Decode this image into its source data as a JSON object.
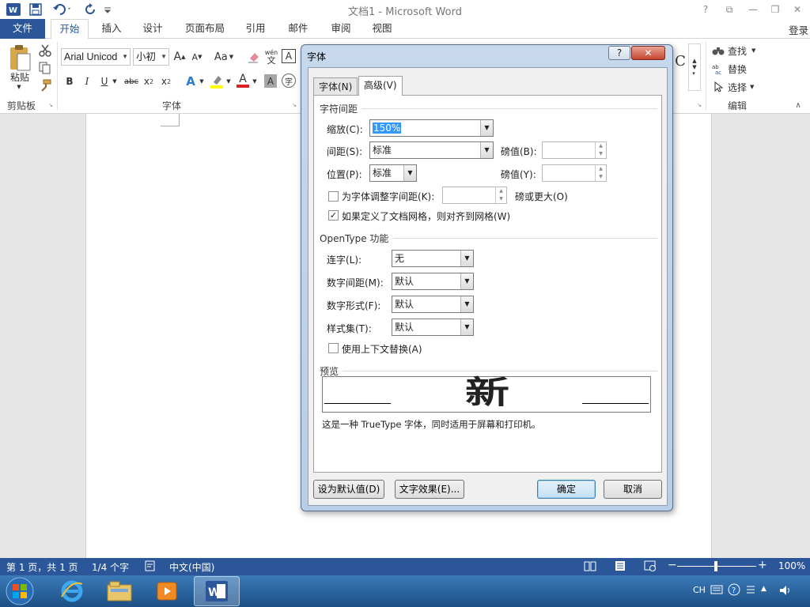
{
  "titlebar": {
    "title": "文档1 - Microsoft Word",
    "help": "?",
    "restore_ribbon": "⧉",
    "minimize": "—",
    "maximize": "❐",
    "close": "✕"
  },
  "tabs": {
    "file": "文件",
    "items": [
      "开始",
      "插入",
      "设计",
      "页面布局",
      "引用",
      "邮件",
      "审阅",
      "视图"
    ],
    "login": "登录"
  },
  "ribbon": {
    "clipboard": {
      "paste": "粘贴",
      "label": "剪贴板"
    },
    "font": {
      "font_name": "Arial Unicod",
      "font_size": "小初",
      "grow": "A",
      "shrink": "A",
      "case": "Aa",
      "pinyin_top": "wén",
      "pinyin_bottom": "文",
      "border_char": "A",
      "bold": "B",
      "italic": "I",
      "underline": "U",
      "strike": "abc",
      "sub": "x",
      "sub_mark": "2",
      "sup": "x",
      "sup_mark": "2",
      "effects": "A",
      "color_a": "A",
      "shade_a": "A",
      "enclose": "字",
      "label": "字体"
    },
    "editing": {
      "find": "查找",
      "replace": "替换",
      "select": "选择",
      "label": "编辑"
    },
    "styles_partial": "C"
  },
  "dialog": {
    "title": "字体",
    "help": "?",
    "close": "✕",
    "tabs": [
      "字体(N)",
      "高级(V)"
    ],
    "char_spacing": {
      "heading": "字符间距",
      "scale_label": "缩放(C):",
      "scale_value": "150%",
      "spacing_label": "间距(S):",
      "spacing_value": "标准",
      "spacing_by_label": "磅值(B):",
      "position_label": "位置(P):",
      "position_value": "标准",
      "position_by_label": "磅值(Y):",
      "kerning_label": "为字体调整字间距(K):",
      "kerning_suffix": "磅或更大(O)",
      "kerning_checked": false,
      "grid_label": "如果定义了文档网格，则对齐到网格(W)",
      "grid_checked": true
    },
    "opentype": {
      "heading": "OpenType 功能",
      "ligatures_label": "连字(L):",
      "ligatures_value": "无",
      "numspacing_label": "数字间距(M):",
      "numspacing_value": "默认",
      "numforms_label": "数字形式(F):",
      "numforms_value": "默认",
      "stylesets_label": "样式集(T):",
      "stylesets_value": "默认",
      "contextual_label": "使用上下文替换(A)",
      "contextual_checked": false
    },
    "preview": {
      "heading": "预览",
      "sample": "新",
      "description": "这是一种 TrueType 字体，同时适用于屏幕和打印机。"
    },
    "buttons": {
      "set_default": "设为默认值(D)",
      "text_effects": "文字效果(E)...",
      "ok": "确定",
      "cancel": "取消"
    }
  },
  "statusbar": {
    "page": "第 1 页，共 1 页",
    "words": "1/4 个字",
    "language": "中文(中国)",
    "zoom": "100%",
    "zoom_minus": "−",
    "zoom_plus": "+"
  },
  "taskbar": {
    "lang": "CH"
  }
}
